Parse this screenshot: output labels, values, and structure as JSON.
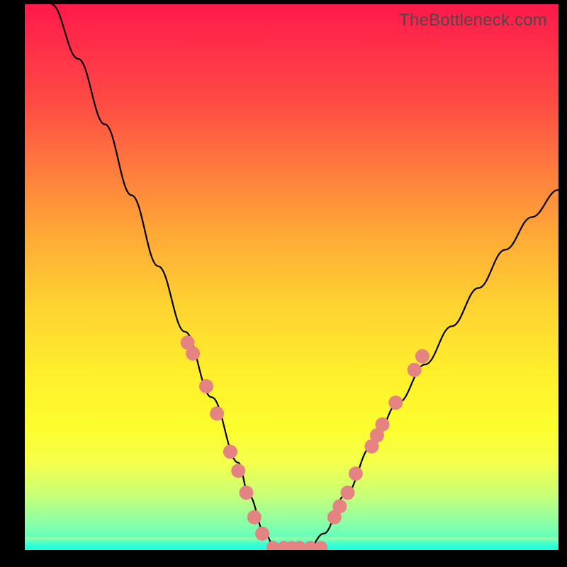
{
  "watermark": "TheBottleneck.com",
  "chart_data": {
    "type": "line",
    "title": "",
    "xlabel": "",
    "ylabel": "",
    "xlim": [
      0,
      100
    ],
    "ylim": [
      0,
      100
    ],
    "grid": false,
    "series": [
      {
        "name": "curve",
        "x": [
          5,
          10,
          15,
          20,
          25,
          30,
          35,
          40,
          42,
          45,
          47,
          50,
          53,
          56,
          60,
          65,
          70,
          75,
          80,
          85,
          90,
          95,
          100
        ],
        "values": [
          100,
          90,
          78,
          65,
          52,
          40,
          28,
          16,
          10,
          3,
          0,
          0,
          0,
          3,
          10,
          19,
          27,
          34,
          41,
          48,
          55,
          61,
          66
        ]
      }
    ],
    "markers_left": [
      {
        "x": 30.5,
        "y": 38
      },
      {
        "x": 31.5,
        "y": 36
      },
      {
        "x": 34,
        "y": 30
      },
      {
        "x": 36,
        "y": 25
      },
      {
        "x": 38.5,
        "y": 18
      },
      {
        "x": 40,
        "y": 14.5
      },
      {
        "x": 41.5,
        "y": 10.5
      },
      {
        "x": 43,
        "y": 6
      },
      {
        "x": 44.5,
        "y": 3
      }
    ],
    "markers_right": [
      {
        "x": 58,
        "y": 6
      },
      {
        "x": 59,
        "y": 8
      },
      {
        "x": 60.5,
        "y": 10.5
      },
      {
        "x": 62,
        "y": 14
      },
      {
        "x": 65,
        "y": 19
      },
      {
        "x": 66,
        "y": 21
      },
      {
        "x": 67,
        "y": 23
      },
      {
        "x": 69.5,
        "y": 27
      },
      {
        "x": 73,
        "y": 33
      },
      {
        "x": 74.5,
        "y": 35.5
      }
    ],
    "markers_bottom": [
      {
        "x": 46.5,
        "y": 0.5
      },
      {
        "x": 48.5,
        "y": 0.5
      },
      {
        "x": 50,
        "y": 0.5
      },
      {
        "x": 51.5,
        "y": 0.5
      },
      {
        "x": 53.5,
        "y": 0.5
      },
      {
        "x": 55.5,
        "y": 0.5
      }
    ],
    "marker_color": "#e58282",
    "background_gradient": [
      "#ff1a4a",
      "#ff7a3e",
      "#ffd231",
      "#fcfe2e",
      "#42ffcf"
    ]
  }
}
